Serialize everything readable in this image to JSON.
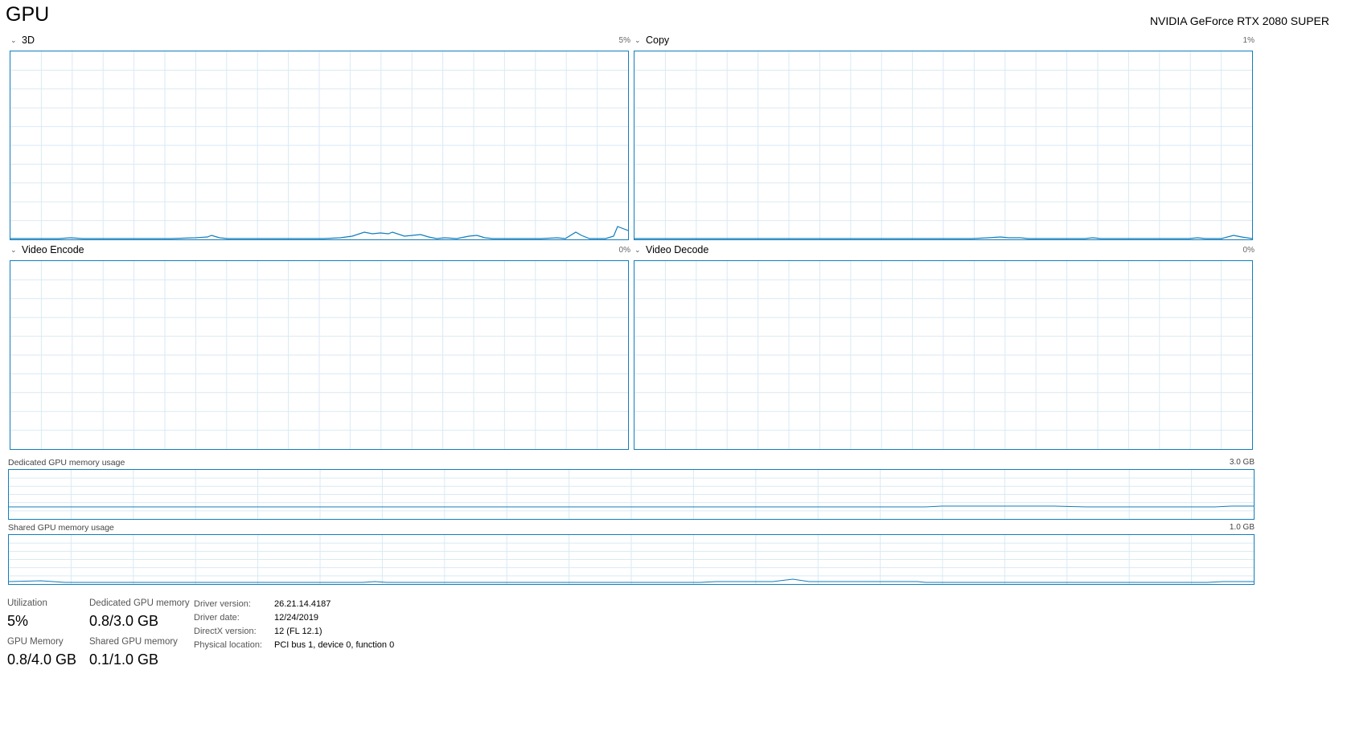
{
  "header": {
    "title": "GPU",
    "device": "NVIDIA GeForce RTX 2080 SUPER"
  },
  "engines": [
    {
      "label": "3D",
      "max": "5%"
    },
    {
      "label": "Copy",
      "max": "1%"
    },
    {
      "label": "Video Encode",
      "max": "0%"
    },
    {
      "label": "Video Decode",
      "max": "0%"
    }
  ],
  "memory_graphs": {
    "dedicated": {
      "label": "Dedicated GPU memory usage",
      "max": "3.0 GB"
    },
    "shared": {
      "label": "Shared GPU memory usage",
      "max": "1.0 GB"
    }
  },
  "stats": {
    "utilization": {
      "label": "Utilization",
      "value": "5%"
    },
    "dedicated_memory": {
      "label": "Dedicated GPU memory",
      "value": "0.8/3.0 GB"
    },
    "gpu_memory": {
      "label": "GPU Memory",
      "value": "0.8/4.0 GB"
    },
    "shared_memory": {
      "label": "Shared GPU memory",
      "value": "0.1/1.0 GB"
    }
  },
  "info": {
    "driver_version": {
      "label": "Driver version:",
      "value": "26.21.14.4187"
    },
    "driver_date": {
      "label": "Driver date:",
      "value": "12/24/2019"
    },
    "directx_version": {
      "label": "DirectX version:",
      "value": "12 (FL 12.1)"
    },
    "physical_location": {
      "label": "Physical location:",
      "value": "PCI bus 1, device 0, function 0"
    }
  },
  "colors": {
    "accent": "#117dbb",
    "grid": "#d9eaf4"
  }
}
